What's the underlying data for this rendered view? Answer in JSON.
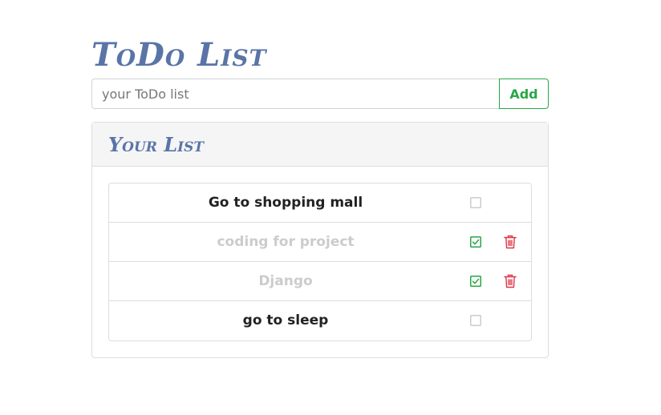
{
  "header": {
    "title": "ToDo List"
  },
  "add_form": {
    "placeholder": "your ToDo list",
    "add_label": "Add"
  },
  "list_card": {
    "title": "Your List",
    "items": [
      {
        "text": "Go to shopping mall",
        "completed": false
      },
      {
        "text": "coding for project",
        "completed": true
      },
      {
        "text": "Django",
        "completed": true
      },
      {
        "text": "go to sleep",
        "completed": false
      }
    ]
  },
  "colors": {
    "title": "#5a74a8",
    "add_button": "#28a745",
    "check_done": "#28a745",
    "check_empty": "#cccccc",
    "delete_icon": "#dc3545",
    "completed_text": "#cccccc",
    "pending_text": "#222222"
  },
  "icons": {
    "checkbox_done": "check-square-icon",
    "checkbox_empty": "square-icon",
    "delete": "trash-icon"
  }
}
